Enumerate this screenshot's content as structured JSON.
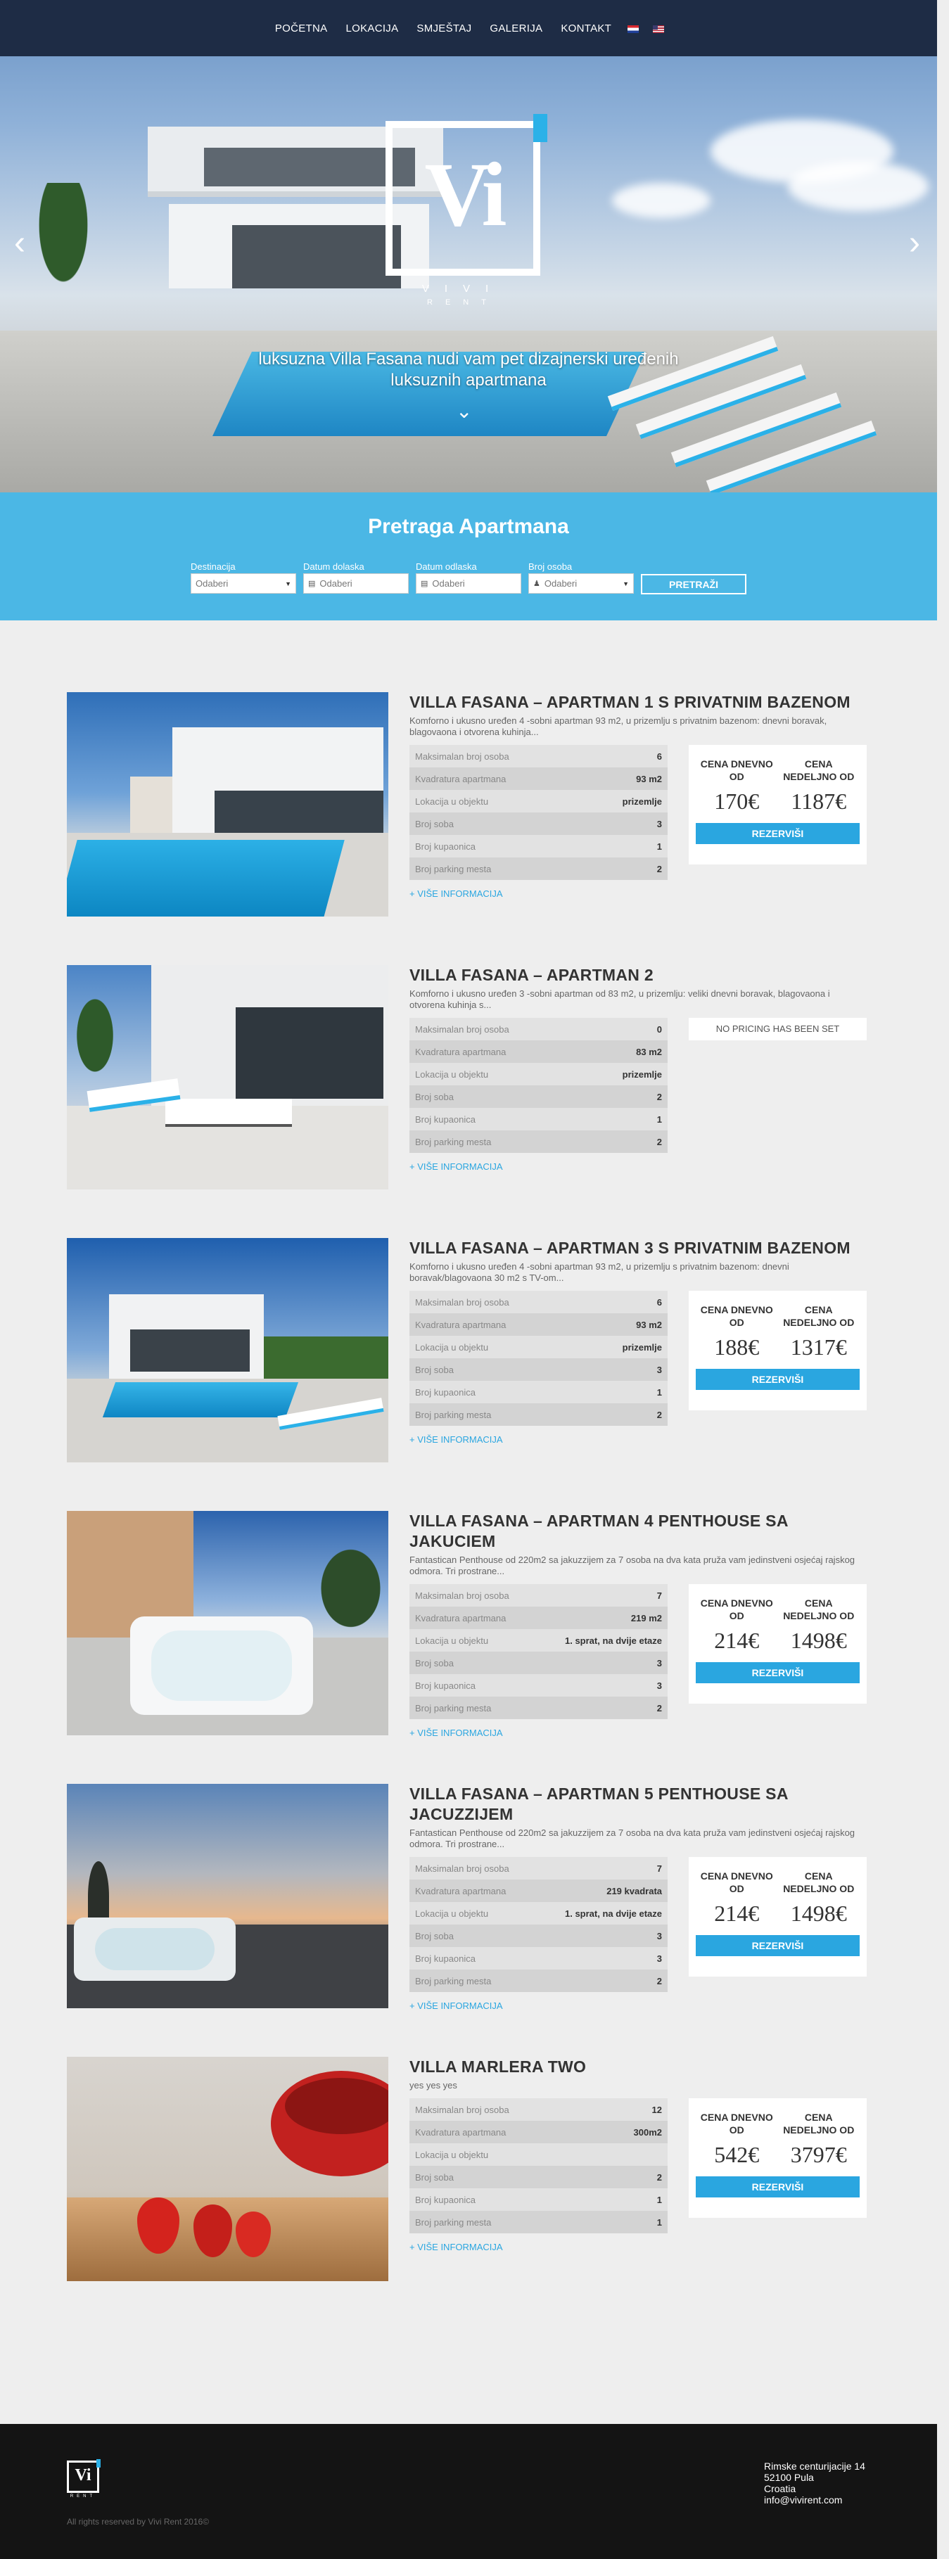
{
  "nav": {
    "items": [
      "POČETNA",
      "LOKACIJA",
      "SMJEŠTAJ",
      "GALERIJA",
      "KONTAKT"
    ],
    "languages": [
      "hr-flag",
      "en-flag"
    ]
  },
  "hero": {
    "logo_letters": "Vi",
    "brand": "VIVI",
    "brand_sub": "RENT",
    "tagline_line1": "luksuzna Villa Fasana nudi vam pet dizajnerski uređenih",
    "tagline_line2": "luksuznih apartmana",
    "prev_icon": "chevron-left",
    "next_icon": "chevron-right",
    "scroll_icon": "chevron-down"
  },
  "search": {
    "title": "Pretraga Apartmana",
    "destination": {
      "label": "Destinacija",
      "value": "Odaberi"
    },
    "arrival": {
      "label": "Datum dolaska",
      "placeholder": "Odaberi"
    },
    "departure": {
      "label": "Datum odlaska",
      "placeholder": "Odaberi"
    },
    "persons": {
      "label": "Broj osoba",
      "value": "Odaberi"
    },
    "button": "PRETRAŽI"
  },
  "labels": {
    "max_persons": "Maksimalan broj osoba",
    "area": "Kvadratura apartmana",
    "location": "Lokacija u objektu",
    "rooms": "Broj soba",
    "bathrooms": "Broj kupaonica",
    "parking": "Broj parking mesta",
    "daily": "CENA DNEVNO OD",
    "weekly": "CENA NEDELJNO OD",
    "reserve": "REZERVIŠI",
    "more": "+ VIŠE INFORMACIJA",
    "no_pricing": "NO PRICING HAS BEEN SET"
  },
  "listings": [
    {
      "title": "VILLA FASANA – APARTMAN 1 S PRIVATNIM BAZENOM",
      "desc": "Komforno i ukusno uređen 4 -sobni apartman 93 m2, u prizemlju s privatnim bazenom: dnevni boravak, blagovaona i otvorena kuhinja...",
      "max_persons": "6",
      "area": "93 m2",
      "location": "prizemlje",
      "rooms": "3",
      "bathrooms": "1",
      "parking": "2",
      "daily": "170€",
      "weekly": "1187€"
    },
    {
      "title": "VILLA FASANA – APARTMAN 2",
      "desc": "Komforno i ukusno uređen 3 -sobni apartman od 83 m2, u prizemlju: veliki dnevni boravak, blagovaona i otvorena kuhinja s...",
      "max_persons": "0",
      "area": "83 m2",
      "location": "prizemlje",
      "rooms": "2",
      "bathrooms": "1",
      "parking": "2",
      "daily": "",
      "weekly": ""
    },
    {
      "title": "VILLA FASANA – APARTMAN 3 S PRIVATNIM BAZENOM",
      "desc": "Komforno i ukusno uređen 4 -sobni apartman 93 m2, u prizemlju s privatnim bazenom: dnevni boravak/blagovaona 30 m2 s TV-om...",
      "max_persons": "6",
      "area": "93 m2",
      "location": "prizemlje",
      "rooms": "3",
      "bathrooms": "1",
      "parking": "2",
      "daily": "188€",
      "weekly": "1317€"
    },
    {
      "title": "VILLA FASANA – APARTMAN 4 PENTHOUSE SA JAKUCIEM",
      "desc": "Fantastican Penthouse od 220m2 sa jakuzzijem za 7 osoba na dva kata pruža vam jedinstveni osjećaj rajskog odmora. Tri prostrane...",
      "max_persons": "7",
      "area": "219 m2",
      "location": "1. sprat, na dvije etaze",
      "rooms": "3",
      "bathrooms": "3",
      "parking": "2",
      "daily": "214€",
      "weekly": "1498€"
    },
    {
      "title": "VILLA FASANA – APARTMAN 5 PENTHOUSE SA JACUZZIJEM",
      "desc": "Fantastican Penthouse od 220m2 sa jakuzzijem za 7 osoba na dva kata pruža vam jedinstveni osjećaj rajskog odmora. Tri prostrane...",
      "max_persons": "7",
      "area": "219 kvadrata",
      "location": "1. sprat, na dvije etaze",
      "rooms": "3",
      "bathrooms": "3",
      "parking": "2",
      "daily": "214€",
      "weekly": "1498€"
    },
    {
      "title": "VILLA MARLERA TWO",
      "desc": "yes yes yes",
      "max_persons": "12",
      "area": "300m2",
      "location": "",
      "rooms": "2",
      "bathrooms": "1",
      "parking": "1",
      "daily": "542€",
      "weekly": "3797€"
    }
  ],
  "footer": {
    "logo_letters": "Vi",
    "logo_sub": "RENT",
    "copyright": "All rights reserved by Vivi Rent 2016©",
    "address": [
      "Rimske centurijacije 14",
      "52100 Pula",
      "Croatia",
      "info@vivirent.com"
    ]
  },
  "colors": {
    "nav": "#1e2c45",
    "accent": "#2bb1e8",
    "search_bg": "#4bb7e5",
    "footer": "#141414"
  }
}
